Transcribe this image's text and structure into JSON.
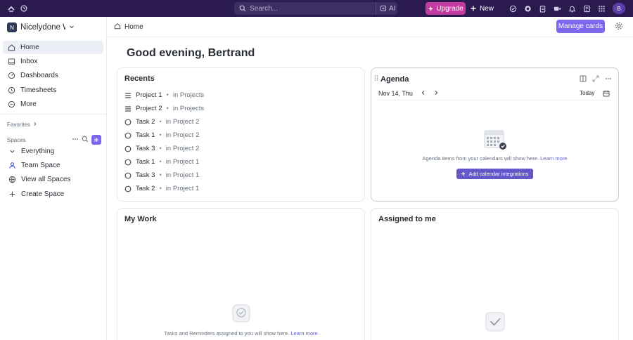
{
  "topbar": {
    "search_placeholder": "Search...",
    "ai_label": "AI",
    "upgrade_label": "Upgrade",
    "new_label": "New",
    "avatar_initial": "B"
  },
  "sidebar": {
    "workspace_initial": "N",
    "workspace_name": "Nicelydone Workspace",
    "nav": [
      {
        "label": "Home",
        "icon": "home-icon",
        "active": true
      },
      {
        "label": "Inbox",
        "icon": "inbox-icon"
      },
      {
        "label": "Dashboards",
        "icon": "dashboards-icon"
      },
      {
        "label": "Timesheets",
        "icon": "timesheets-icon"
      },
      {
        "label": "More",
        "icon": "more-icon"
      }
    ],
    "favorites_label": "Favorites",
    "spaces_label": "Spaces",
    "spaces": [
      {
        "label": "Everything",
        "icon": "everything-icon"
      },
      {
        "label": "Team Space",
        "icon": "team-space-icon"
      },
      {
        "label": "View all Spaces",
        "icon": "view-all-spaces-icon"
      },
      {
        "label": "Create Space",
        "icon": "create-space-icon"
      }
    ]
  },
  "header": {
    "breadcrumb": "Home",
    "manage_cards": "Manage cards"
  },
  "greeting": "Good evening, Bertrand",
  "recents": {
    "title": "Recents",
    "items": [
      {
        "name": "Project 1",
        "location": "in Projects",
        "icon": "list-icon"
      },
      {
        "name": "Project 2",
        "location": "in Projects",
        "icon": "list-icon"
      },
      {
        "name": "Task 2",
        "location": "in Project 2",
        "icon": "task-icon"
      },
      {
        "name": "Task 1",
        "location": "in Project 2",
        "icon": "task-icon"
      },
      {
        "name": "Task 3",
        "location": "in Project 2",
        "icon": "task-icon"
      },
      {
        "name": "Task 1",
        "location": "in Project 1",
        "icon": "task-icon"
      },
      {
        "name": "Task 3",
        "location": "in Project 1",
        "icon": "task-icon"
      },
      {
        "name": "Task 2",
        "location": "in Project 1",
        "icon": "task-icon"
      }
    ]
  },
  "agenda": {
    "title": "Agenda",
    "date": "Nov 14, Thu",
    "today_label": "Today",
    "empty_text": "Agenda items from your calendars will show here.",
    "learn_more": "Learn more",
    "add_button": "Add calendar integrations"
  },
  "my_work": {
    "title": "My Work",
    "empty_text": "Tasks and Reminders assigned to you will show here.",
    "learn_more": "Learn more"
  },
  "assigned": {
    "title": "Assigned to me"
  }
}
